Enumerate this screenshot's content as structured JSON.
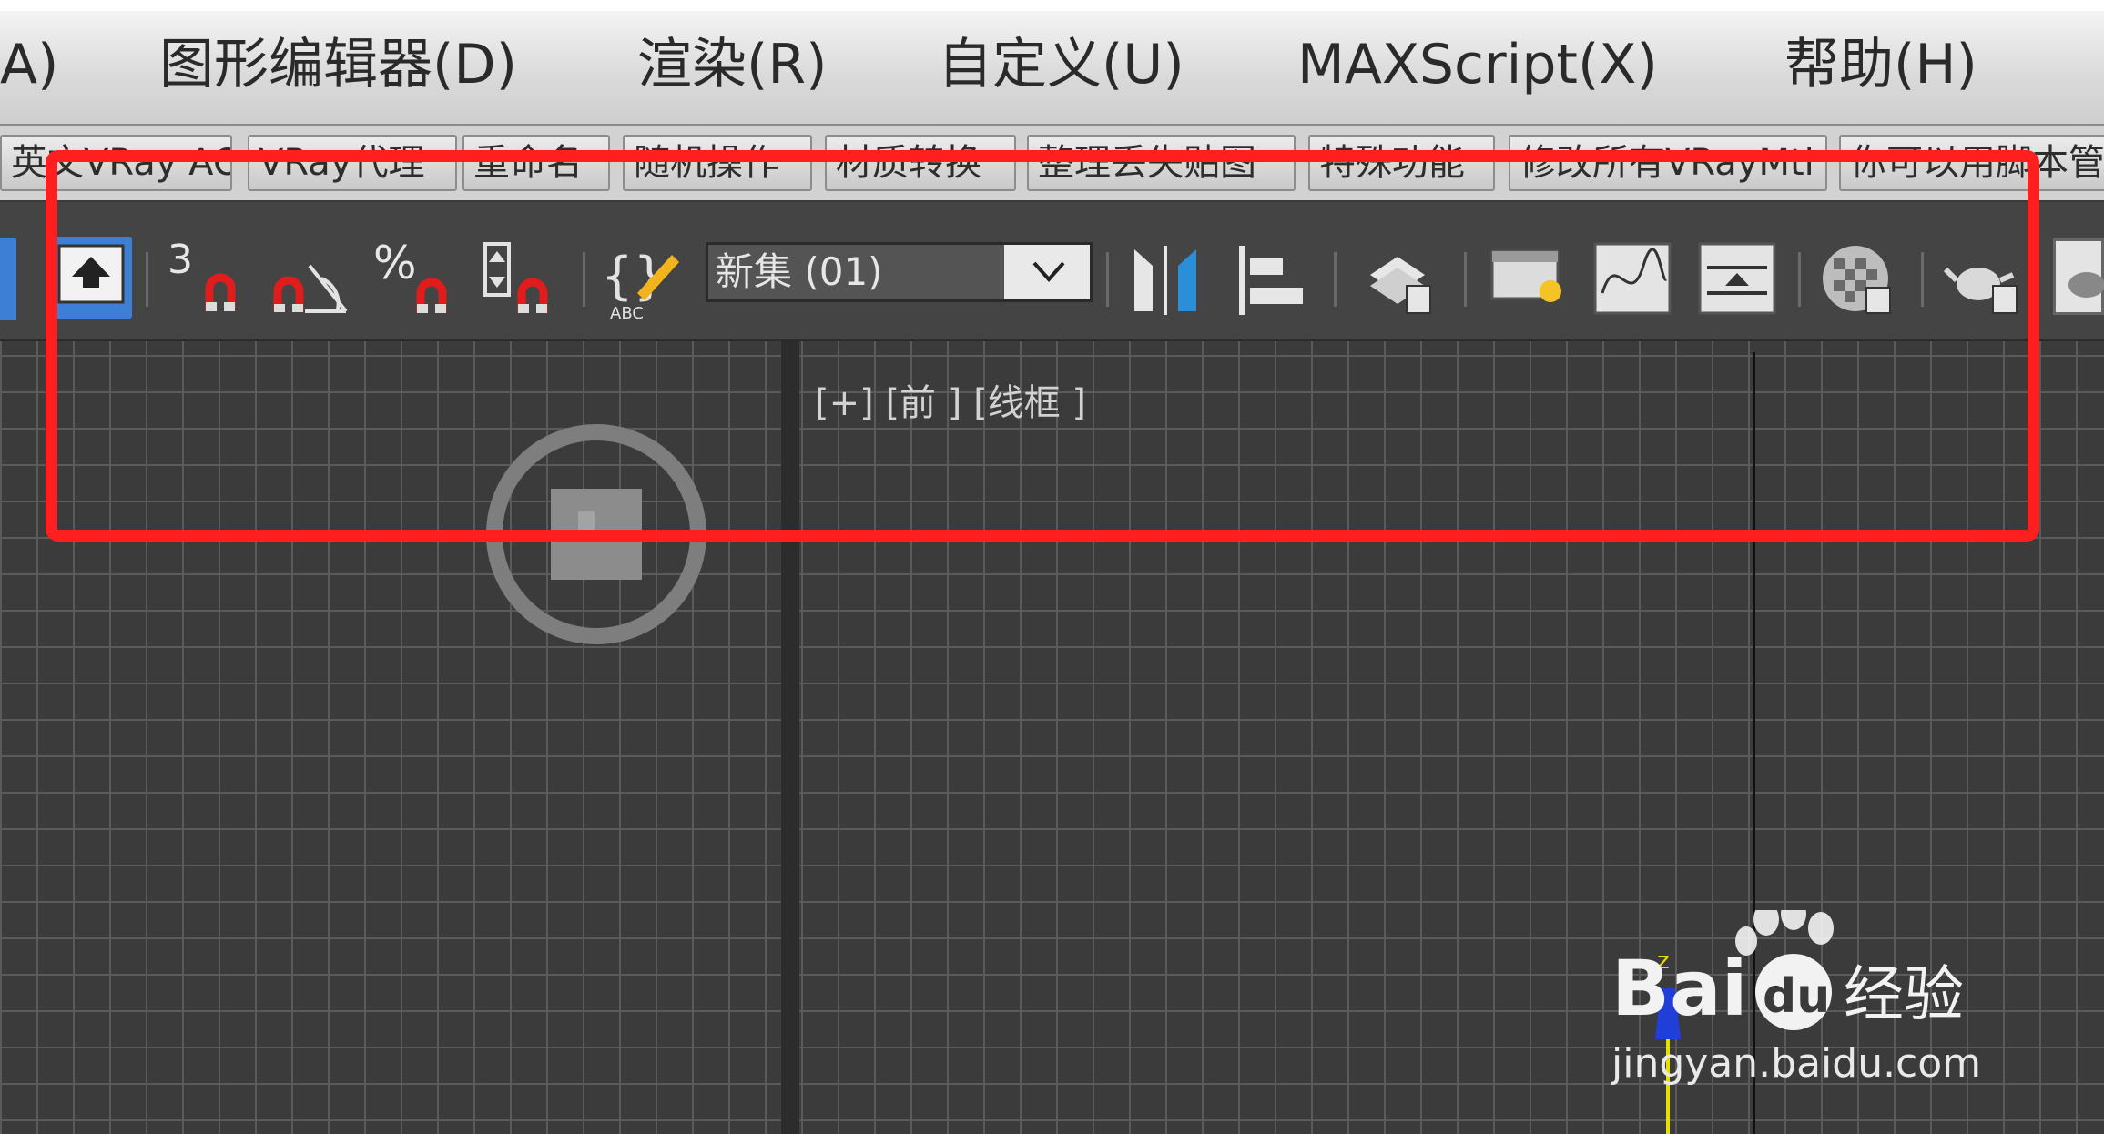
{
  "menubar": {
    "items": [
      "A)",
      "图形编辑器(D)",
      "渲染(R)",
      "自定义(U)",
      "MAXScript(X)",
      "帮助(H)"
    ]
  },
  "plugin_toolbar": {
    "buttons": [
      "英文VRay AO",
      "VRay代理",
      "重命名",
      "随机操作",
      "材质转换",
      "整理丢失贴图",
      "特殊功能",
      "修改所有VRayMtl",
      "你可以用脚本管"
    ]
  },
  "main_toolbar": {
    "snap_3_label": "3",
    "percent_label": "%",
    "abc_label": "ABC",
    "selection_set": {
      "value": "新集 (01)"
    }
  },
  "viewport": {
    "label": "[+] [前 ] [线框 ]",
    "axis_label": "z"
  },
  "watermark": {
    "brand": "Bai",
    "brand_suffix": "du",
    "product": "经验",
    "url": "jingyan.baidu.com"
  },
  "colors": {
    "annotation_red": "#ff1f1f",
    "viewport_bg": "#3b3b3b",
    "grid_line": "#5b5b5b",
    "toolbar_bg": "#444444",
    "axis_blue": "#1f3fd8"
  }
}
